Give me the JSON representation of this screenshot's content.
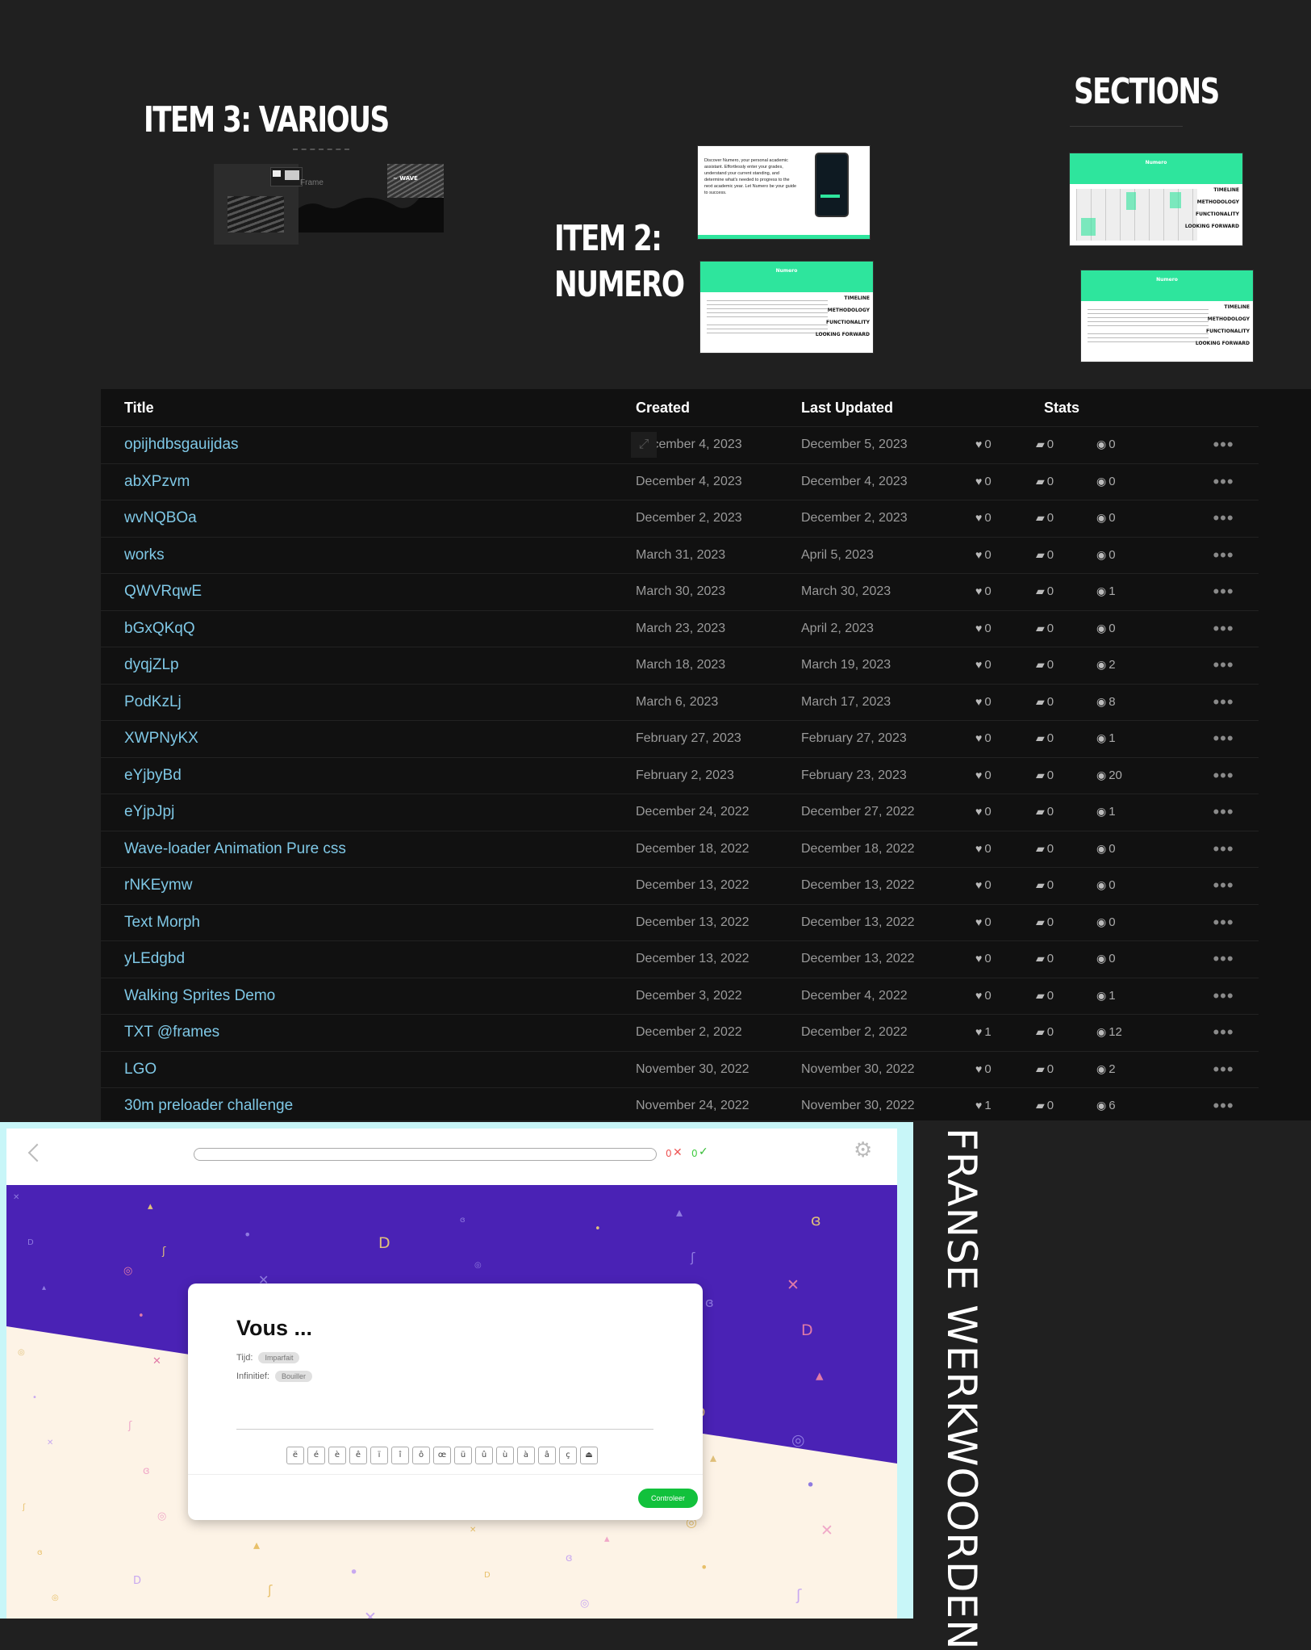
{
  "posters": {
    "item3": "ITEM 3:  VARIOUS",
    "item2_line1": "ITEM 2:",
    "item2_line2": "NUMERO",
    "sections": "SECTIONS"
  },
  "thumbnails": {
    "various_frame_label": "Frame",
    "various_wave_label": "~ WAVE",
    "numero_intro": "Discover Numero, your personal academic assistant. Effortlessly enter your grades, understand your current standing, and determine what's needed to progress to the next academic year. Let Numero be your guide to success.",
    "numero_header": "Numero",
    "side_labels": [
      "TIMELINE",
      "METHODOLOGY",
      "FUNCTIONALITY",
      "LOOKING FORWARD"
    ]
  },
  "table": {
    "headers": {
      "title": "Title",
      "created": "Created",
      "updated": "Last Updated",
      "stats": "Stats"
    },
    "rows": [
      {
        "title": "opijhdbsgauijdas",
        "created": "December 4, 2023",
        "updated": "December 5, 2023",
        "likes": "0",
        "comments": "0",
        "views": "0"
      },
      {
        "title": "abXPzvm",
        "created": "December 4, 2023",
        "updated": "December 4, 2023",
        "likes": "0",
        "comments": "0",
        "views": "0"
      },
      {
        "title": "wvNQBOa",
        "created": "December 2, 2023",
        "updated": "December 2, 2023",
        "likes": "0",
        "comments": "0",
        "views": "0"
      },
      {
        "title": "works",
        "created": "March 31, 2023",
        "updated": "April 5, 2023",
        "likes": "0",
        "comments": "0",
        "views": "0"
      },
      {
        "title": "QWVRqwE",
        "created": "March 30, 2023",
        "updated": "March 30, 2023",
        "likes": "0",
        "comments": "0",
        "views": "1"
      },
      {
        "title": "bGxQKqQ",
        "created": "March 23, 2023",
        "updated": "April 2, 2023",
        "likes": "0",
        "comments": "0",
        "views": "0"
      },
      {
        "title": "dyqjZLp",
        "created": "March 18, 2023",
        "updated": "March 19, 2023",
        "likes": "0",
        "comments": "0",
        "views": "2"
      },
      {
        "title": "PodKzLj",
        "created": "March 6, 2023",
        "updated": "March 17, 2023",
        "likes": "0",
        "comments": "0",
        "views": "8"
      },
      {
        "title": "XWPNyKX",
        "created": "February 27, 2023",
        "updated": "February 27, 2023",
        "likes": "0",
        "comments": "0",
        "views": "1"
      },
      {
        "title": "eYjbyBd",
        "created": "February 2, 2023",
        "updated": "February 23, 2023",
        "likes": "0",
        "comments": "0",
        "views": "20"
      },
      {
        "title": "eYjpJpj",
        "created": "December 24, 2022",
        "updated": "December 27, 2022",
        "likes": "0",
        "comments": "0",
        "views": "1"
      },
      {
        "title": "Wave-loader Animation Pure css",
        "created": "December 18, 2022",
        "updated": "December 18, 2022",
        "likes": "0",
        "comments": "0",
        "views": "0"
      },
      {
        "title": "rNKEymw",
        "created": "December 13, 2022",
        "updated": "December 13, 2022",
        "likes": "0",
        "comments": "0",
        "views": "0"
      },
      {
        "title": "Text Morph",
        "created": "December 13, 2022",
        "updated": "December 13, 2022",
        "likes": "0",
        "comments": "0",
        "views": "0"
      },
      {
        "title": "yLEdgbd",
        "created": "December 13, 2022",
        "updated": "December 13, 2022",
        "likes": "0",
        "comments": "0",
        "views": "0"
      },
      {
        "title": "Walking Sprites Demo",
        "created": "December 3, 2022",
        "updated": "December 4, 2022",
        "likes": "0",
        "comments": "0",
        "views": "1"
      },
      {
        "title": "TXT @frames",
        "created": "December 2, 2022",
        "updated": "December 2, 2022",
        "likes": "1",
        "comments": "0",
        "views": "12"
      },
      {
        "title": "LGO",
        "created": "November 30, 2022",
        "updated": "November 30, 2022",
        "likes": "0",
        "comments": "0",
        "views": "2"
      },
      {
        "title": "30m preloader challenge",
        "created": "November 24, 2022",
        "updated": "November 30, 2022",
        "likes": "1",
        "comments": "0",
        "views": "6"
      }
    ],
    "icons": {
      "like": "heart-icon",
      "comment": "comment-icon",
      "view": "eye-icon",
      "more": "more-dots-icon",
      "expand": "expand-icon"
    }
  },
  "quiz": {
    "wrong_count": "0",
    "right_count": "0",
    "question": "Vous ...",
    "tijd_label": "Tijd:",
    "tijd_value": "Imparfait",
    "infinitief_label": "Infinitief:",
    "infinitief_value": "Bouiller",
    "keys": [
      "ë",
      "é",
      "è",
      "ê",
      "ï",
      "î",
      "ô",
      "œ",
      "ü",
      "û",
      "ù",
      "à",
      "â",
      "ç",
      "⏏"
    ],
    "check_button": "Controleer",
    "colors": {
      "purple": "#4a22b5",
      "cream": "#fdf3e6",
      "green": "#12c13c",
      "border": "#c8f6f8"
    }
  },
  "side_title": "FRANSE WERKWOORDEN"
}
